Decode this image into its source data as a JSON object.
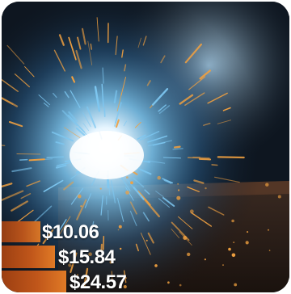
{
  "image": {
    "subject": "welding sparks",
    "colors": {
      "spark_core": "#f4fbff",
      "spark_glow": "#7ec8f2",
      "ember": "#f0a040",
      "background": "#0e1620",
      "bar_accent": "#c0561a"
    }
  },
  "price_bars": [
    {
      "label": "$10.06"
    },
    {
      "label": "$15.84"
    },
    {
      "label": "$24.57"
    }
  ]
}
